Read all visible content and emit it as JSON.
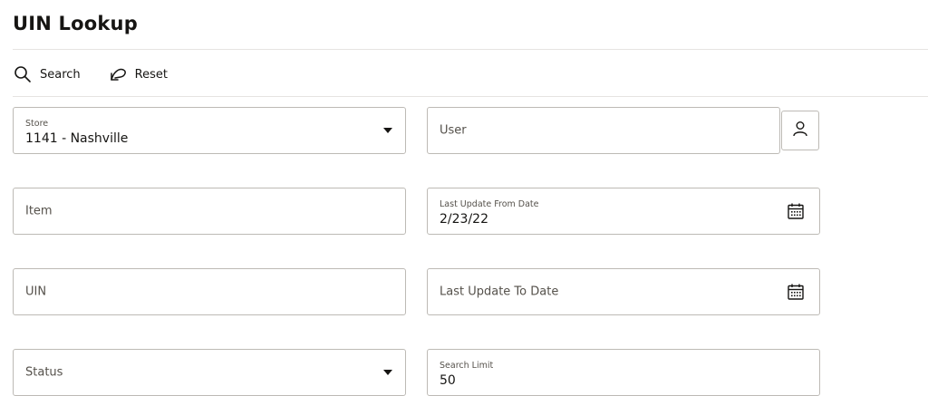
{
  "header": {
    "title": "UIN Lookup"
  },
  "toolbar": {
    "search_label": "Search",
    "reset_label": "Reset"
  },
  "form": {
    "store": {
      "label": "Store",
      "value": "1141 - Nashville"
    },
    "user": {
      "placeholder": "User"
    },
    "item": {
      "placeholder": "Item"
    },
    "last_update_from": {
      "label": "Last Update From Date",
      "value": "2/23/22"
    },
    "uin": {
      "placeholder": "UIN"
    },
    "last_update_to": {
      "placeholder": "Last Update To Date"
    },
    "status": {
      "placeholder": "Status"
    },
    "search_limit": {
      "label": "Search Limit",
      "value": "50"
    }
  },
  "icons": {
    "search": "search-icon",
    "reset": "undo-icon",
    "dropdown": "chevron-down-icon",
    "calendar": "calendar-icon",
    "user": "person-icon"
  },
  "colors": {
    "text": "#161513",
    "label": "#55514b",
    "border": "#bdbab5",
    "divider": "#e6e4e1"
  }
}
